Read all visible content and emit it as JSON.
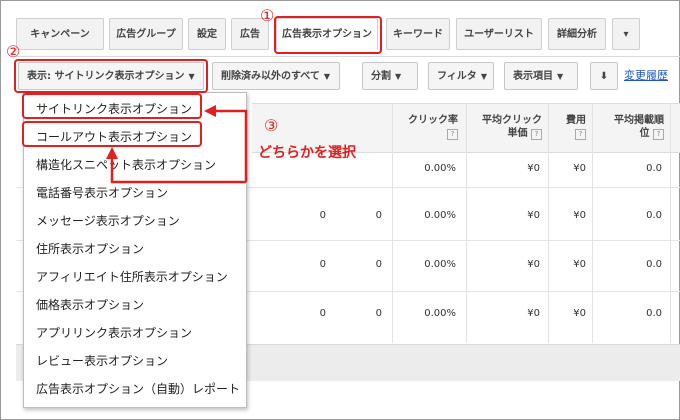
{
  "tabs": [
    {
      "label": "キャンペーン"
    },
    {
      "label": "広告グループ"
    },
    {
      "label": "設定"
    },
    {
      "label": "広告"
    },
    {
      "label": "広告表示オプション"
    },
    {
      "label": "キーワード"
    },
    {
      "label": "ユーザーリスト"
    },
    {
      "label": "詳細分析"
    },
    {
      "label": "▾"
    }
  ],
  "toolbar": {
    "view_label": "表示: サイトリンク表示オプション",
    "filter_deleted_label": "削除済み以外のすべて",
    "segment_label": "分割",
    "filter_label": "フィルタ",
    "columns_label": "表示項目",
    "download_icon": "download-icon",
    "history_link": "変更履歴"
  },
  "table": {
    "headers": {
      "ctr": "クリック率",
      "avg_cpc_line1": "平均クリック",
      "avg_cpc_line2": "単価",
      "cost": "費用",
      "avg_pos_line1": "平均掲載順",
      "avg_pos_line2": "位",
      "help": "?"
    },
    "rows": [
      {
        "col1": "",
        "col2": "",
        "ctr": "0.00%",
        "cpc": "¥0",
        "cost": "¥0",
        "pos": "0.0"
      },
      {
        "col1": "0",
        "col2": "0",
        "ctr": "0.00%",
        "cpc": "¥0",
        "cost": "¥0",
        "pos": "0.0"
      },
      {
        "col1": "0",
        "col2": "0",
        "ctr": "0.00%",
        "cpc": "¥0",
        "cost": "¥0",
        "pos": "0.0"
      },
      {
        "col1": "0",
        "col2": "0",
        "ctr": "0.00%",
        "cpc": "¥0",
        "cost": "¥0",
        "pos": "0.0"
      }
    ]
  },
  "menu": {
    "items": [
      {
        "label": "サイトリンク表示オプション"
      },
      {
        "label": "コールアウト表示オプション"
      },
      {
        "label": "構造化スニペット表示オプション"
      },
      {
        "label": "電話番号表示オプション"
      },
      {
        "label": "メッセージ表示オプション"
      },
      {
        "label": "住所表示オプション"
      },
      {
        "label": "アフィリエイト住所表示オプション"
      },
      {
        "label": "価格表示オプション"
      },
      {
        "label": "アプリリンク表示オプション"
      },
      {
        "label": "レビュー表示オプション"
      },
      {
        "label": "広告表示オプション（自動）レポート"
      }
    ]
  },
  "annotations": {
    "step1": "①",
    "step2": "②",
    "step3": "③",
    "instruction": "どちらかを選択",
    "color": "#e02020"
  }
}
